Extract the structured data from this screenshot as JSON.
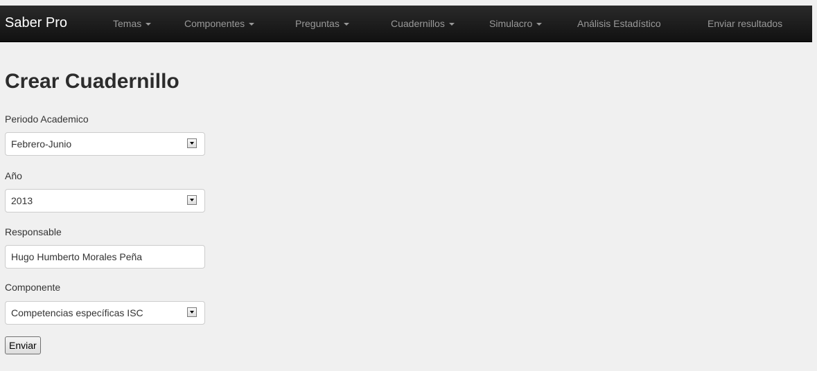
{
  "navbar": {
    "brand": "Saber Pro",
    "items": [
      {
        "label": "Temas",
        "dropdown": true
      },
      {
        "label": "Componentes",
        "dropdown": true
      },
      {
        "label": "Preguntas",
        "dropdown": true
      },
      {
        "label": "Cuadernillos",
        "dropdown": true
      },
      {
        "label": "Simulacro",
        "dropdown": true
      },
      {
        "label": "Análisis Estadístico",
        "dropdown": false
      },
      {
        "label": "Enviar resultados",
        "dropdown": false
      }
    ]
  },
  "page": {
    "title": "Crear Cuadernillo"
  },
  "form": {
    "periodo": {
      "label": "Periodo Academico",
      "value": "Febrero-Junio"
    },
    "anio": {
      "label": "Año",
      "value": "2013"
    },
    "responsable": {
      "label": "Responsable",
      "value": "Hugo Humberto Morales Peña"
    },
    "componente": {
      "label": "Componente",
      "value": "Competencias específicas ISC"
    },
    "submit_label": "Enviar"
  },
  "colors": {
    "navbar_bg": "#1b1b1b",
    "nav_text": "#999999",
    "page_bg": "#f0f0f0"
  }
}
